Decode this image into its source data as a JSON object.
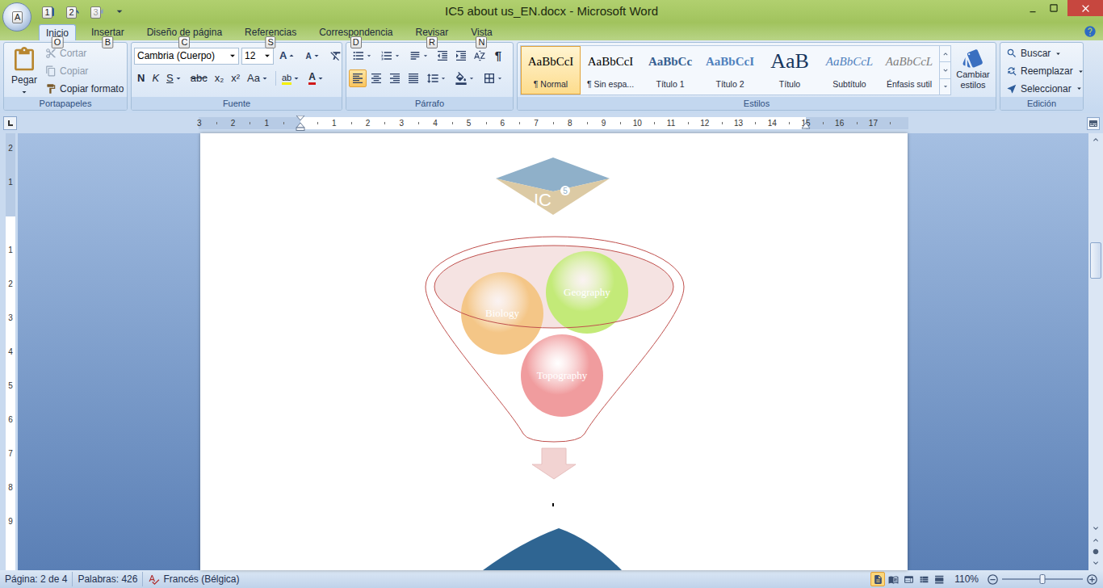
{
  "window": {
    "title": "IC5 about us_EN.docx - Microsoft Word",
    "office_button_keytip": "A"
  },
  "quick_access": [
    {
      "name": "save",
      "keytip": "1",
      "disabled": false
    },
    {
      "name": "undo",
      "keytip": "2",
      "disabled": false
    },
    {
      "name": "redo",
      "keytip": "3",
      "disabled": true
    }
  ],
  "tabs": [
    {
      "label": "Inicio",
      "keytip": "O",
      "selected": true
    },
    {
      "label": "Insertar",
      "keytip": "B",
      "selected": false
    },
    {
      "label": "Diseño de página",
      "keytip": "C",
      "selected": false
    },
    {
      "label": "Referencias",
      "keytip": "S",
      "selected": false
    },
    {
      "label": "Correspondencia",
      "keytip": "D",
      "selected": false
    },
    {
      "label": "Revisar",
      "keytip": "R",
      "selected": false
    },
    {
      "label": "Vista",
      "keytip": "N",
      "selected": false
    }
  ],
  "ribbon": {
    "clipboard": {
      "label": "Portapapeles",
      "paste": "Pegar",
      "items": [
        {
          "label": "Cortar",
          "disabled": true
        },
        {
          "label": "Copiar",
          "disabled": true
        },
        {
          "label": "Copiar formato",
          "disabled": false
        }
      ]
    },
    "font": {
      "label": "Fuente",
      "name": "Cambria (Cuerpo)",
      "size": "12",
      "grow": "A",
      "shrink": "A",
      "format_buttons": [
        {
          "label": "N",
          "kind": "bold"
        },
        {
          "label": "K",
          "kind": "italic"
        },
        {
          "label": "S",
          "kind": "underline"
        },
        {
          "label": "abc",
          "kind": "strike"
        },
        {
          "label": "x₂",
          "kind": "plain"
        },
        {
          "label": "x²",
          "kind": "plain"
        },
        {
          "label": "Aa",
          "kind": "case"
        }
      ],
      "highlight": "ab",
      "font_color": "A"
    },
    "paragraph": {
      "label": "Párrafo",
      "pilcrow": "¶",
      "alignments": [
        {
          "name": "left",
          "selected": true
        },
        {
          "name": "center",
          "selected": false
        },
        {
          "name": "right",
          "selected": false
        },
        {
          "name": "justify",
          "selected": false
        }
      ]
    },
    "styles": {
      "label": "Estilos",
      "change": "Cambiar estilos",
      "items": [
        {
          "sample": "AaBbCcI",
          "label": "¶ Normal",
          "kind": "normal",
          "selected": true
        },
        {
          "sample": "AaBbCcI",
          "label": "¶ Sin espa...",
          "kind": "normal",
          "selected": false
        },
        {
          "sample": "AaBbCc",
          "label": "Título 1",
          "kind": "heading1",
          "selected": false
        },
        {
          "sample": "AaBbCcI",
          "label": "Título 2",
          "kind": "heading2",
          "selected": false
        },
        {
          "sample": "AaB",
          "label": "Título",
          "kind": "title",
          "selected": false
        },
        {
          "sample": "AaBbCcL",
          "label": "Subtítulo",
          "kind": "subtitle",
          "selected": false
        },
        {
          "sample": "AaBbCcL",
          "label": "Énfasis sutil",
          "kind": "emphasis",
          "selected": false
        }
      ]
    },
    "editing": {
      "label": "Edición",
      "items": [
        {
          "label": "Buscar",
          "kind": "find"
        },
        {
          "label": "Reemplazar",
          "kind": "replace"
        },
        {
          "label": "Seleccionar",
          "kind": "select"
        }
      ]
    }
  },
  "rulers": {
    "horizontal": {
      "before": [
        "3",
        "2",
        "1"
      ],
      "after": [
        "1",
        "2",
        "3",
        "4",
        "5",
        "6",
        "7",
        "8",
        "9",
        "10",
        "11",
        "12",
        "13",
        "14",
        "15",
        "16",
        "17"
      ]
    },
    "vertical": {
      "before": [
        "2",
        "1"
      ],
      "after": [
        "1",
        "2",
        "3",
        "4",
        "5",
        "6",
        "7",
        "8",
        "9"
      ]
    }
  },
  "document": {
    "logo": {
      "text": "IC",
      "superscript": "5"
    },
    "circles": [
      {
        "label": "Biology",
        "color": "#f4c687"
      },
      {
        "label": "Geography",
        "color": "#c3ea78"
      },
      {
        "label": "Topography",
        "color": "#f09c9e"
      }
    ]
  },
  "status_bar": {
    "page": "Página: 2 de 4",
    "words": "Palabras: 426",
    "language": "Francés (Bélgica)",
    "zoom": "110%",
    "zoom_level": 0.5,
    "views": [
      {
        "name": "print-layout",
        "selected": true
      },
      {
        "name": "full-screen-reading",
        "selected": false
      },
      {
        "name": "web-layout",
        "selected": false
      },
      {
        "name": "outline",
        "selected": false
      },
      {
        "name": "draft",
        "selected": false
      }
    ]
  }
}
